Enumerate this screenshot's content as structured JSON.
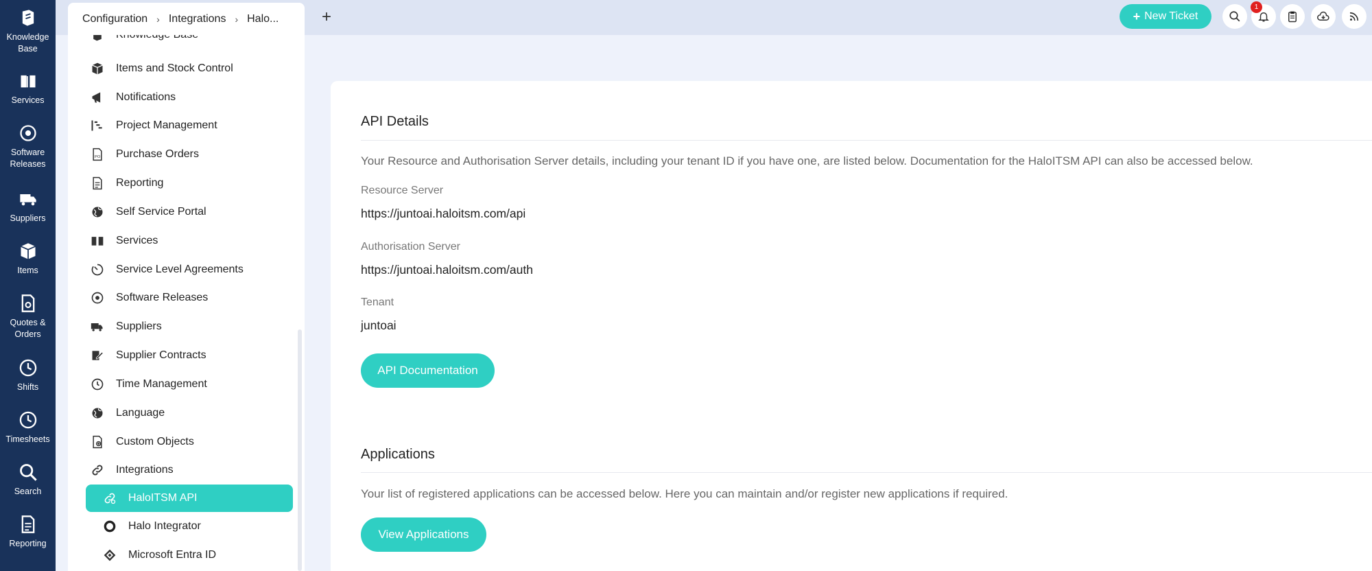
{
  "rail": [
    {
      "label": "Knowledge Base",
      "icon": "knowledge-base-icon"
    },
    {
      "label": "Services",
      "icon": "book-icon"
    },
    {
      "label": "Software Releases",
      "icon": "disc-icon"
    },
    {
      "label": "Suppliers",
      "icon": "truck-icon"
    },
    {
      "label": "Items",
      "icon": "box-icon"
    },
    {
      "label": "Quotes & Orders",
      "icon": "quote-doc-icon"
    },
    {
      "label": "Shifts",
      "icon": "clock-icon"
    },
    {
      "label": "Timesheets",
      "icon": "clock-icon"
    },
    {
      "label": "Search",
      "icon": "search-icon"
    },
    {
      "label": "Reporting",
      "icon": "report-icon"
    }
  ],
  "breadcrumb": {
    "item1": "Configuration",
    "item2": "Integrations",
    "item3": "Halo..."
  },
  "topbar": {
    "add_tab": "+",
    "new_ticket": "New Ticket",
    "notification_count": "1"
  },
  "sidebar": {
    "cut_item": "Knowledge Base",
    "items": [
      "Items and Stock Control",
      "Notifications",
      "Project Management",
      "Purchase Orders",
      "Reporting",
      "Self Service Portal",
      "Services",
      "Service Level Agreements",
      "Software Releases",
      "Suppliers",
      "Supplier Contracts",
      "Time Management",
      "Language",
      "Custom Objects",
      "Integrations"
    ],
    "sub_items": [
      "HaloITSM API",
      "Halo Integrator",
      "Microsoft Entra ID"
    ]
  },
  "api": {
    "title": "API Details",
    "desc": "Your Resource and Authorisation Server details, including your tenant ID if you have one, are listed below. Documentation for the HaloITSM API can also be accessed below.",
    "resource_label": "Resource Server",
    "resource_value": "https://juntoai.haloitsm.com/api",
    "auth_label": "Authorisation Server",
    "auth_value": "https://juntoai.haloitsm.com/auth",
    "tenant_label": "Tenant",
    "tenant_value": "juntoai",
    "doc_button": "API Documentation"
  },
  "apps": {
    "title": "Applications",
    "desc": "Your list of registered applications can be accessed below. Here you can maintain and/or register new applications if required.",
    "button": "View Applications"
  },
  "colors": {
    "rail": "#19325a",
    "accent": "#2fcfc3",
    "badge": "#e0201f"
  }
}
